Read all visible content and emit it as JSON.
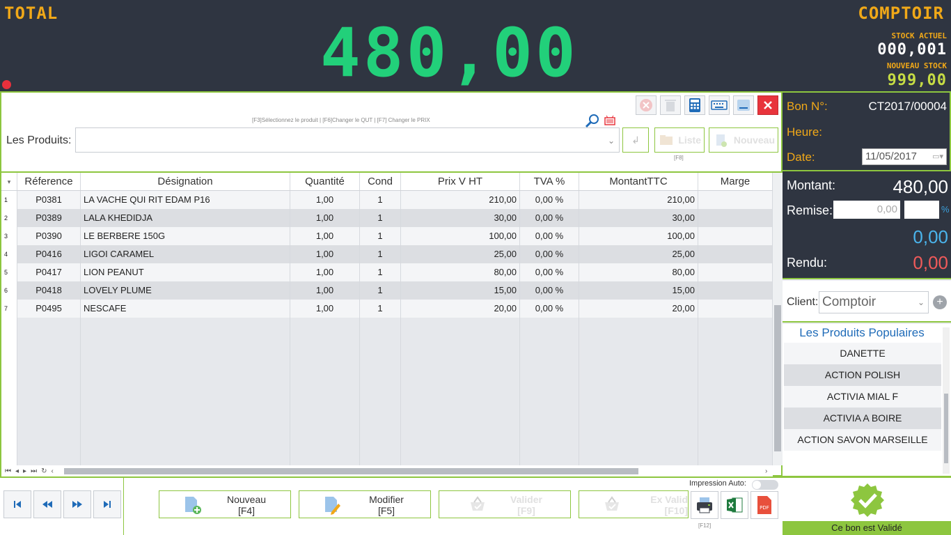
{
  "header": {
    "total_label": "TOTAL",
    "total_value": "480,00",
    "mode_label": "COMPTOIR",
    "stock_actuel_label": "STOCK ACTUEL",
    "stock_actuel_value": "000,001",
    "nouveau_stock_label": "NOUVEAU STOCK",
    "nouveau_stock_value": "999,00"
  },
  "product_bar": {
    "hint": "[F3]Sélectionnez le produit | [F6]Changer le QUT | [F7] Changer le PRIX",
    "label": "Les Produits:",
    "value": "",
    "liste_label": "Liste",
    "liste_key": "[F8]",
    "nouveau_label": "Nouveau"
  },
  "grid": {
    "columns": [
      "Réference",
      "Désignation",
      "Quantité",
      "Cond",
      "Prix V HT",
      "TVA %",
      "MontantTTC",
      "Marge"
    ],
    "rows": [
      {
        "n": "1",
        "ref": "P0381",
        "designation": "LA VACHE QUI RIT EDAM P16",
        "qte": "1,00",
        "cond": "1",
        "prix": "210,00",
        "tva": "0,00 %",
        "ttc": "210,00",
        "marge": ""
      },
      {
        "n": "2",
        "ref": "P0389",
        "designation": "LALA KHEDIDJA",
        "qte": "1,00",
        "cond": "1",
        "prix": "30,00",
        "tva": "0,00 %",
        "ttc": "30,00",
        "marge": ""
      },
      {
        "n": "3",
        "ref": "P0390",
        "designation": "LE BERBERE 150G",
        "qte": "1,00",
        "cond": "1",
        "prix": "100,00",
        "tva": "0,00 %",
        "ttc": "100,00",
        "marge": ""
      },
      {
        "n": "4",
        "ref": "P0416",
        "designation": "LIGOI CARAMEL",
        "qte": "1,00",
        "cond": "1",
        "prix": "25,00",
        "tva": "0,00 %",
        "ttc": "25,00",
        "marge": ""
      },
      {
        "n": "5",
        "ref": "P0417",
        "designation": "LION PEANUT",
        "qte": "1,00",
        "cond": "1",
        "prix": "80,00",
        "tva": "0,00 %",
        "ttc": "80,00",
        "marge": ""
      },
      {
        "n": "6",
        "ref": "P0418",
        "designation": "LOVELY PLUME",
        "qte": "1,00",
        "cond": "1",
        "prix": "15,00",
        "tva": "0,00 %",
        "ttc": "15,00",
        "marge": ""
      },
      {
        "n": "7",
        "ref": "P0495",
        "designation": "NESCAFE",
        "qte": "1,00",
        "cond": "1",
        "prix": "20,00",
        "tva": "0,00 %",
        "ttc": "20,00",
        "marge": ""
      }
    ]
  },
  "info": {
    "bon_label": "Bon N°:",
    "bon_value": "CT2017/00004",
    "heure_label": "Heure:",
    "heure_value": "",
    "date_label": "Date:",
    "date_value": "11/05/2017"
  },
  "money": {
    "montant_label": "Montant:",
    "montant_value": "480,00",
    "remise_label": "Remise:",
    "remise_value": "0,00",
    "remise_pct_value": "",
    "pct_sign": "%",
    "net_value": "0,00",
    "rendu_label": "Rendu:",
    "rendu_value": "0,00"
  },
  "client": {
    "label": "Client:",
    "value": "Comptoir"
  },
  "popular": {
    "title": "Les Produits Populaires",
    "items": [
      "DANETTE",
      "ACTION POLISH",
      "ACTIVIA MIAL F",
      "ACTIVIA A BOIRE",
      "ACTION SAVON MARSEILLE"
    ]
  },
  "actions": {
    "nouveau": {
      "label": "Nouveau",
      "key": "[F4]"
    },
    "modifier": {
      "label": "Modifier",
      "key": "[F5]"
    },
    "valider": {
      "label": "Valider",
      "key": "[F9]"
    },
    "ex_valider": {
      "label": "Ex Valid",
      "key": "[F10]"
    },
    "impression_label": "Impression Auto:",
    "print_key": "[F12]"
  },
  "status": {
    "validated_text": "Ce bon est Validé"
  },
  "colors": {
    "accent_green": "#8dc63f",
    "display_green": "#22d07a",
    "display_orange": "#f0a818",
    "dark_panel": "#2f3541"
  }
}
